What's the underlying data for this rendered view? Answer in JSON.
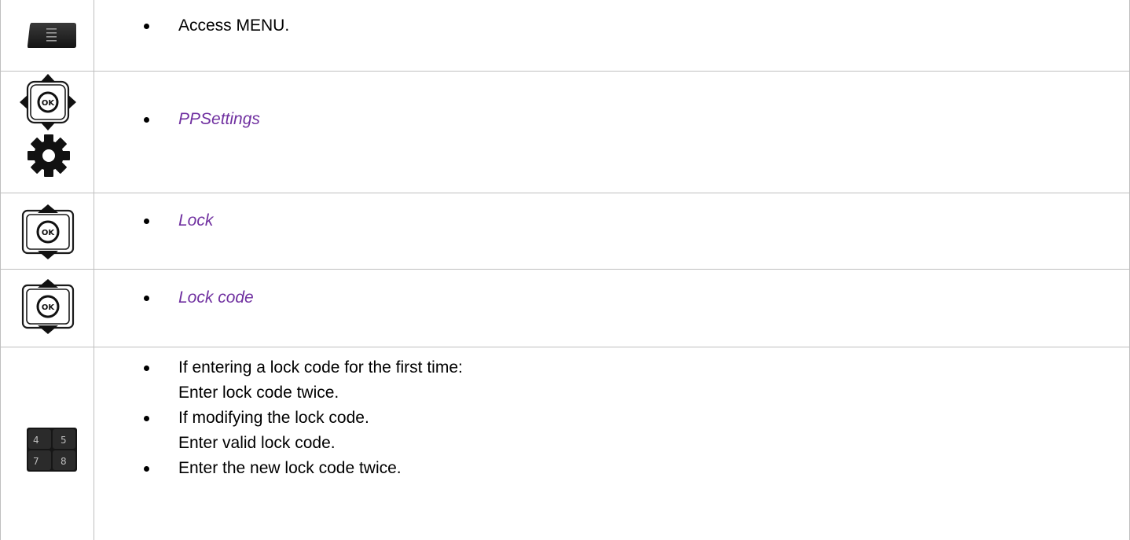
{
  "colors": {
    "menu_item": "#7030a0",
    "border": "#bfbfbf",
    "key_dark": "#1f1f1f"
  },
  "steps": [
    {
      "icons": [
        "menu-key-icon"
      ],
      "bullets": [
        {
          "text": "Access MENU.",
          "style": "plain"
        }
      ]
    },
    {
      "icons": [
        "four-way-navigator-icon",
        "gear-icon"
      ],
      "bullets": [
        {
          "text": "PPSettings",
          "style": "menu-item"
        }
      ]
    },
    {
      "icons": [
        "up-down-navigator-icon"
      ],
      "bullets": [
        {
          "text": "Lock",
          "style": "menu-item"
        }
      ]
    },
    {
      "icons": [
        "up-down-navigator-icon"
      ],
      "bullets": [
        {
          "text": "Lock code",
          "style": "menu-item"
        }
      ]
    },
    {
      "icons": [
        "keypad-icon"
      ],
      "bullets": [
        {
          "text": "If entering a lock code for the first time:",
          "line2": "Enter lock code twice.",
          "style": "plain"
        },
        {
          "text": "If modifying the lock code.",
          "line2": "Enter valid lock code.",
          "style": "plain"
        },
        {
          "text": "Enter the new lock code twice.",
          "style": "plain"
        }
      ]
    }
  ],
  "icon_labels": {
    "ok": "OK",
    "keys": [
      "4",
      "5",
      "7",
      "8"
    ]
  }
}
